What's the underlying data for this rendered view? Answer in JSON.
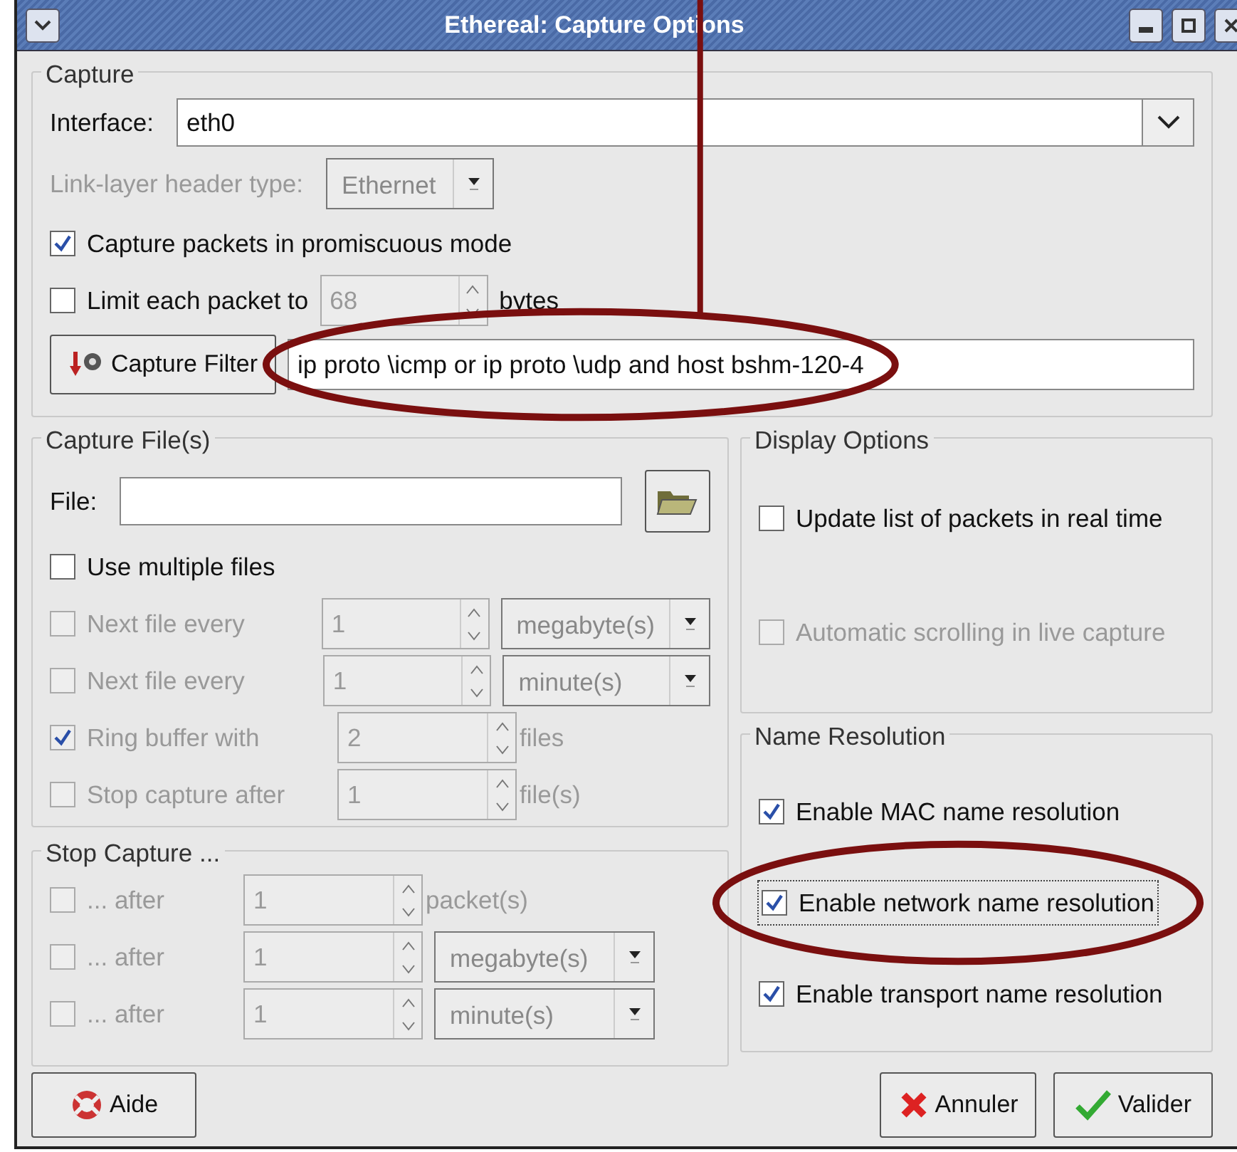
{
  "window": {
    "title": "Ethereal: Capture Options"
  },
  "capture": {
    "title": "Capture",
    "interface": {
      "label": "Interface:",
      "value": "eth0"
    },
    "link_layer": {
      "label": "Link-layer header type:",
      "value": "Ethernet",
      "disabled": true
    },
    "promiscuous": {
      "label": "Capture packets in promiscuous mode",
      "checked": true
    },
    "limit": {
      "label": "Limit each packet to",
      "checked": false,
      "value": "68",
      "unit": "bytes",
      "disabled": true
    },
    "filter": {
      "button": "Capture Filter",
      "value": "ip proto \\icmp or ip proto \\udp and host bshm-120-4",
      "highlighted": true,
      "pointer": true
    }
  },
  "capture_files": {
    "title": "Capture File(s)",
    "file_label": "File:",
    "multiple": {
      "label": "Use multiple files",
      "checked": false
    },
    "rows": [
      {
        "label": "Next file every",
        "checked": false,
        "disabled": true,
        "value": "1",
        "unit": "megabyte(s)",
        "kind": "combo"
      },
      {
        "label": "Next file every",
        "checked": false,
        "disabled": true,
        "value": "1",
        "unit": "minute(s)",
        "kind": "combo"
      },
      {
        "label": "Ring buffer with",
        "checked": true,
        "disabled": true,
        "value": "2",
        "unit": "files",
        "kind": "text"
      },
      {
        "label": "Stop capture after",
        "checked": false,
        "disabled": true,
        "value": "1",
        "unit": "file(s)",
        "kind": "text"
      }
    ]
  },
  "stop_capture": {
    "title": "Stop Capture ...",
    "rows": [
      {
        "label": "... after",
        "checked": false,
        "disabled": true,
        "value": "1",
        "unit": "packet(s)",
        "kind": "text"
      },
      {
        "label": "... after",
        "checked": false,
        "disabled": true,
        "value": "1",
        "unit": "megabyte(s)",
        "kind": "combo"
      },
      {
        "label": "... after",
        "checked": false,
        "disabled": true,
        "value": "1",
        "unit": "minute(s)",
        "kind": "combo"
      }
    ]
  },
  "display_options": {
    "title": "Display Options",
    "items": [
      {
        "label": "Update list of packets in real time",
        "checked": false,
        "disabled": false
      },
      {
        "label": "Automatic scrolling in live capture",
        "checked": false,
        "disabled": true
      }
    ]
  },
  "name_resolution": {
    "title": "Name Resolution",
    "items": [
      {
        "label": "Enable MAC name resolution",
        "checked": true,
        "focused": false,
        "highlighted": false
      },
      {
        "label": "Enable network name resolution",
        "checked": true,
        "focused": true,
        "highlighted": true
      },
      {
        "label": "Enable transport name resolution",
        "checked": true,
        "focused": false,
        "highlighted": false
      }
    ]
  },
  "buttons": [
    {
      "label": "Aide",
      "kind": "help"
    },
    {
      "label": "Annuler",
      "kind": "cancel"
    },
    {
      "label": "Valider",
      "kind": "ok"
    }
  ]
}
